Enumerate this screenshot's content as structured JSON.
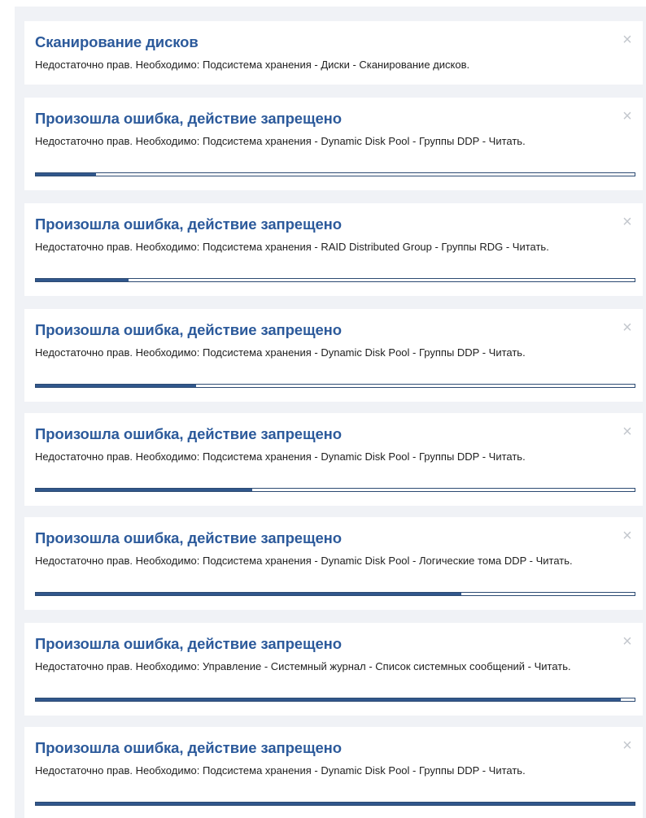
{
  "colors": {
    "panel_background": "#f0f2f6",
    "toast_background": "#ffffff",
    "title": "#2c5a9b",
    "progress_fill": "#31578c",
    "progress_border": "#2c4a72",
    "close_icon": "#c3c7cd"
  },
  "notifications": [
    {
      "title": "Сканирование дисков",
      "message": "Недостаточно прав. Необходимо: Подсистема хранения - Диски - Сканирование дисков.",
      "close_icon": "close-icon",
      "close_glyph": "×",
      "has_progress": false,
      "progress": 0
    },
    {
      "title": "Произошла ошибка, действие запрещено",
      "message": "Недостаточно прав. Необходимо: Подсистема хранения - Dynamic Disk Pool - Группы DDP - Читать.",
      "close_icon": "close-icon",
      "close_glyph": "×",
      "has_progress": true,
      "progress": 0.1
    },
    {
      "title": "Произошла ошибка, действие запрещено",
      "message": "Недостаточно прав. Необходимо: Подсистема хранения - RAID Distributed Group - Группы RDG - Читать.",
      "close_icon": "close-icon",
      "close_glyph": "×",
      "has_progress": true,
      "progress": 0.155
    },
    {
      "title": "Произошла ошибка, действие запрещено",
      "message": "Недостаточно прав. Необходимо: Подсистема хранения - Dynamic Disk Pool - Группы DDP - Читать.",
      "close_icon": "close-icon",
      "close_glyph": "×",
      "has_progress": true,
      "progress": 0.267
    },
    {
      "title": "Произошла ошибка, действие запрещено",
      "message": "Недостаточно прав. Необходимо: Подсистема хранения - Dynamic Disk Pool - Группы DDP - Читать.",
      "close_icon": "close-icon",
      "close_glyph": "×",
      "has_progress": true,
      "progress": 0.362
    },
    {
      "title": "Произошла ошибка, действие запрещено",
      "message": "Недостаточно прав. Необходимо: Подсистема хранения - Dynamic Disk Pool - Логические тома DDP - Читать.",
      "close_icon": "close-icon",
      "close_glyph": "×",
      "has_progress": true,
      "progress": 0.711
    },
    {
      "title": "Произошла ошибка, действие запрещено",
      "message": "Недостаточно прав. Необходимо: Управление - Системный журнал - Список системных сообщений - Читать.",
      "close_icon": "close-icon",
      "close_glyph": "×",
      "has_progress": true,
      "progress": 0.977
    },
    {
      "title": "Произошла ошибка, действие запрещено",
      "message": "Недостаточно прав. Необходимо: Подсистема хранения - Dynamic Disk Pool - Группы DDP - Читать.",
      "close_icon": "close-icon",
      "close_glyph": "×",
      "has_progress": true,
      "progress": 1.0
    }
  ]
}
